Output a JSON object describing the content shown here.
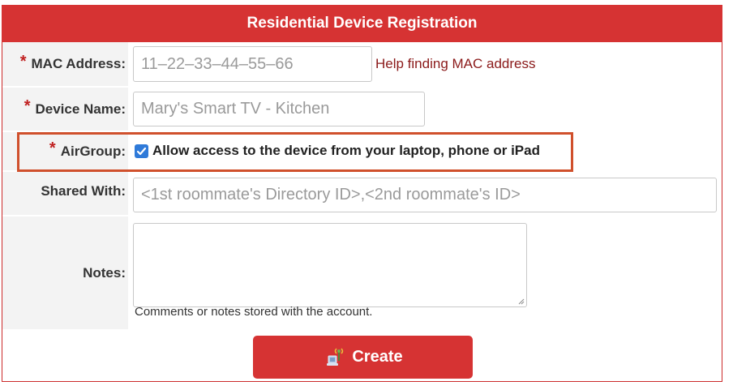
{
  "form": {
    "title": "Residential Device Registration",
    "mac": {
      "label": "MAC Address:",
      "placeholder": "11–22–33–44–55–66",
      "help_link": "Help finding MAC address"
    },
    "device_name": {
      "label": "Device Name:",
      "placeholder": "Mary's Smart TV - Kitchen"
    },
    "airgroup": {
      "label": "AirGroup:",
      "checkbox_label": "Allow access to the device from your laptop, phone or iPad",
      "checked": true
    },
    "shared_with": {
      "label": "Shared With:",
      "placeholder": "<1st roommate's Directory ID>,<2nd roommate's ID>"
    },
    "notes": {
      "label": "Notes:",
      "hint": "Comments or notes stored with the account."
    },
    "required_marker": "*",
    "create_button": "Create",
    "create_icon": "wifi-device-icon"
  },
  "colors": {
    "header_bg": "#d63333",
    "link": "#8b1a1a",
    "highlight_border": "#d0502c",
    "checkbox": "#2f7ad9"
  }
}
